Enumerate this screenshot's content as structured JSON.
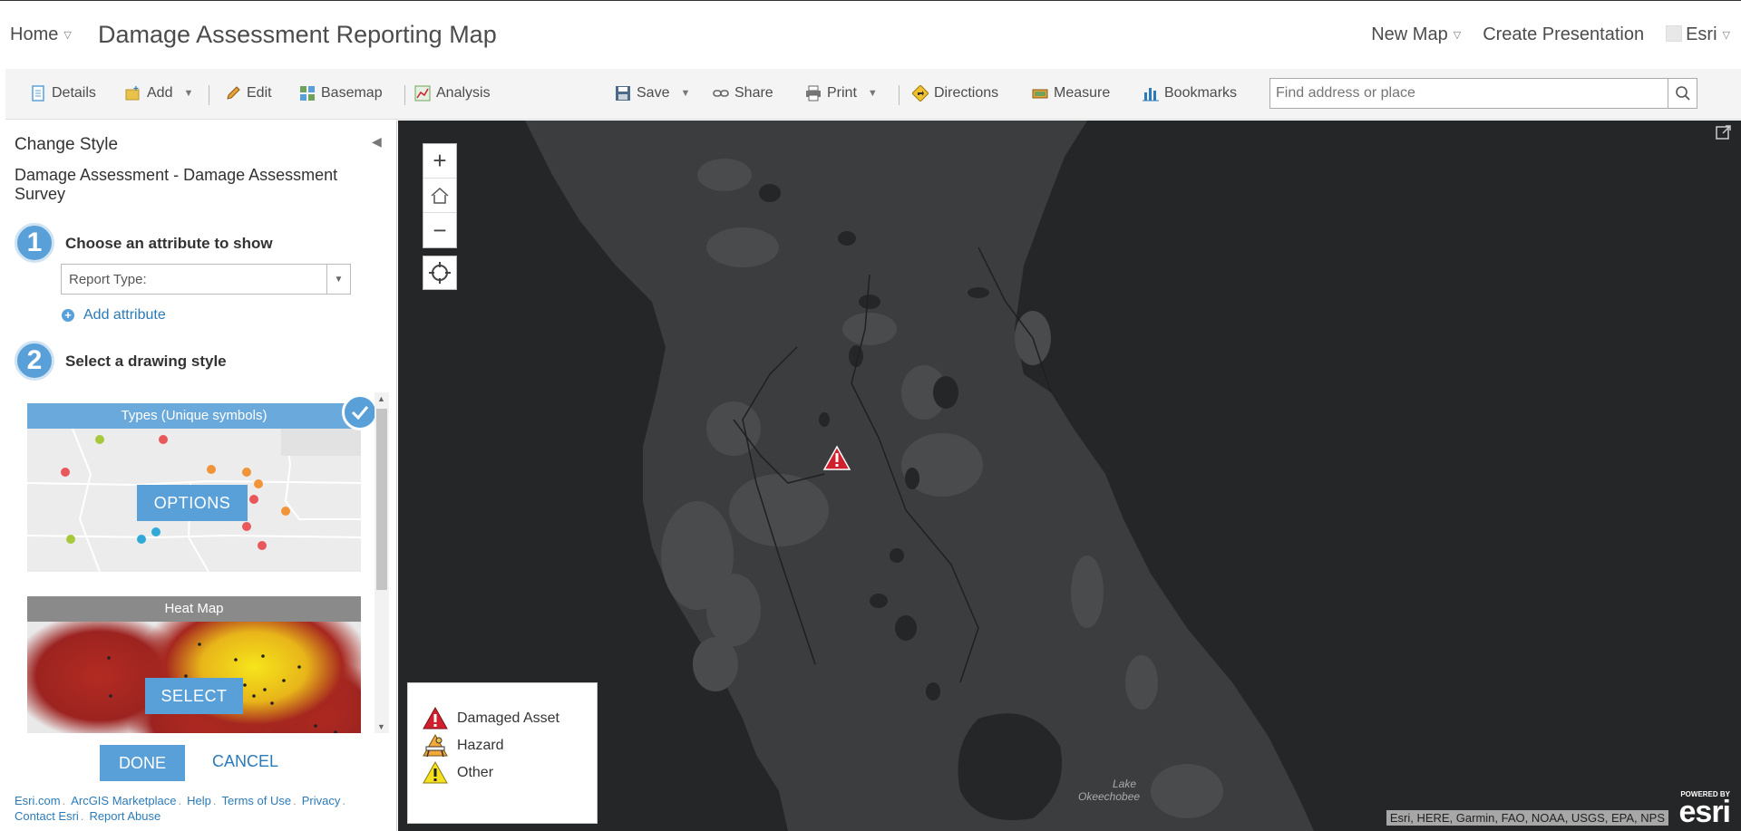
{
  "header": {
    "home_label": "Home",
    "title": "Damage Assessment Reporting Map",
    "new_map_label": "New Map",
    "create_presentation_label": "Create Presentation",
    "user_label": "Esri"
  },
  "toolbar": {
    "details_label": "Details",
    "add_label": "Add",
    "edit_label": "Edit",
    "basemap_label": "Basemap",
    "analysis_label": "Analysis",
    "save_label": "Save",
    "share_label": "Share",
    "print_label": "Print",
    "directions_label": "Directions",
    "measure_label": "Measure",
    "bookmarks_label": "Bookmarks",
    "search_placeholder": "Find address or place"
  },
  "panel": {
    "heading": "Change Style",
    "layer_name": "Damage Assessment - Damage Assessment Survey",
    "step1_number": "1",
    "step1_label": "Choose an attribute to show",
    "attribute_value": "Report Type:",
    "add_attribute_label": "Add attribute",
    "step2_number": "2",
    "step2_label": "Select a drawing style",
    "styles": [
      {
        "name": "Types (Unique symbols)",
        "action": "OPTIONS",
        "selected": true
      },
      {
        "name": "Heat Map",
        "action": "SELECT",
        "selected": false
      }
    ],
    "done_label": "DONE",
    "cancel_label": "CANCEL"
  },
  "footer_links": [
    "Esri.com",
    "ArcGIS Marketplace",
    "Help",
    "Terms of Use",
    "Privacy",
    "Contact Esri",
    "Report Abuse"
  ],
  "map": {
    "legend": [
      {
        "label": "Damaged Asset",
        "icon": "damaged-asset-icon"
      },
      {
        "label": "Hazard",
        "icon": "hazard-icon"
      },
      {
        "label": "Other",
        "icon": "other-icon"
      }
    ],
    "lake_label_1": "Lake",
    "lake_label_2": "Okeechobee",
    "attribution": "Esri, HERE, Garmin, FAO, NOAA, USGS, EPA, NPS",
    "powered_by": "POWERED BY",
    "esri_logo": "esri"
  },
  "colors": {
    "accent": "#5aa0d8",
    "link": "#2b7bb9",
    "map_land": "#3b3c3d",
    "map_water": "#252627",
    "damaged_asset": "#d0202e",
    "other": "#f4e01c"
  }
}
